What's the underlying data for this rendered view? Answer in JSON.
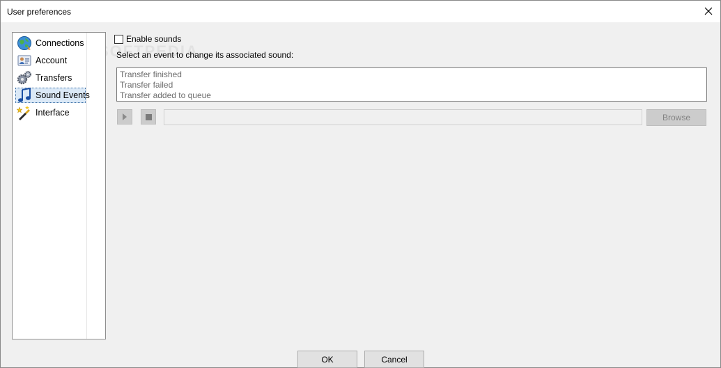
{
  "window": {
    "title": "User preferences"
  },
  "sidebar": {
    "items": [
      {
        "label": "Connections",
        "icon": "globe-icon",
        "selected": false
      },
      {
        "label": "Account",
        "icon": "contact-card-icon",
        "selected": false
      },
      {
        "label": "Transfers",
        "icon": "gears-icon",
        "selected": false
      },
      {
        "label": "Sound Events",
        "icon": "music-note-icon",
        "selected": true
      },
      {
        "label": "Interface",
        "icon": "paintbrush-icon",
        "selected": false
      }
    ]
  },
  "sound": {
    "enable_label": "Enable sounds",
    "enable_checked": false,
    "instruction": "Select an event to change its associated sound:",
    "events": [
      "Transfer finished",
      "Transfer failed",
      "Transfer added to queue"
    ],
    "sound_path": "",
    "browse_label": "Browse"
  },
  "watermark": "SOFTPEDIA",
  "footer": {
    "ok_label": "OK",
    "cancel_label": "Cancel"
  }
}
